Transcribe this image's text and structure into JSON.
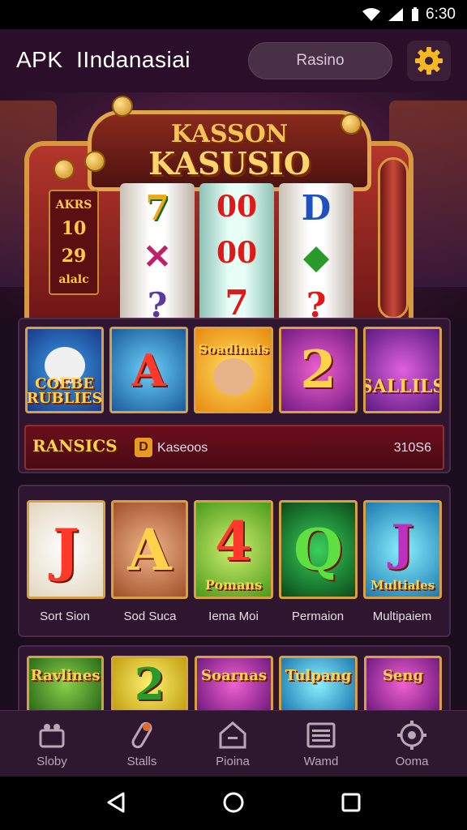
{
  "status_bar": {
    "time": "6:30"
  },
  "header": {
    "app_title": "APK  IIndanasiai",
    "search_placeholder": "Rasino"
  },
  "hero": {
    "logo_line1": "KASSON",
    "logo_line2": "KASUSIO",
    "paytable": [
      "AKRS",
      "10",
      "29",
      "alalc"
    ],
    "reels": [
      [
        "7",
        "✕",
        "?"
      ],
      [
        "00",
        "00",
        "7"
      ],
      [
        "D",
        "◆",
        "?"
      ]
    ]
  },
  "featured_games": [
    {
      "title": "COEBE RUBLIES",
      "bg": "#1a6ab8"
    },
    {
      "title": "A",
      "bg": "#1e8fd0"
    },
    {
      "title": "Soadinais",
      "bg": "#f2a81c"
    },
    {
      "title": "2",
      "bg": "#c02aa0"
    },
    {
      "title": "SALLILS",
      "bg": "#8a1fa8"
    }
  ],
  "jackpot_bar": {
    "logo": "RANSICS",
    "icon": "D",
    "label": "Kaseoos",
    "value": "310S6"
  },
  "game_grid_2": [
    {
      "glyph": "J",
      "caption": "Sort Sion",
      "bg": "#f0e6d6"
    },
    {
      "glyph": "A",
      "caption": "Sod Suca",
      "bg": "#d9875a"
    },
    {
      "glyph": "4",
      "caption": "Iema Moi",
      "bg": "#8fcf3a",
      "label": "Pomans"
    },
    {
      "glyph": "Q",
      "caption": "Permaion",
      "bg": "#1a8a2a"
    },
    {
      "glyph": "J",
      "caption": "Multipaiem",
      "bg": "#2ab0c8",
      "label": "Multiales"
    }
  ],
  "game_grid_3": [
    {
      "title": "Ravlines",
      "bg": "#3a8a2a"
    },
    {
      "title": "2",
      "bg": "#e6d020"
    },
    {
      "title": "Soarnas",
      "bg": "#c02aa0"
    },
    {
      "title": "Tulpang",
      "bg": "#2ab0c8"
    },
    {
      "title": "Seng",
      "bg": "#c02aa0"
    }
  ],
  "bottom_nav": [
    {
      "label": "Sloby",
      "icon": "store-icon"
    },
    {
      "label": "Stalls",
      "icon": "rocket-icon"
    },
    {
      "label": "Pioina",
      "icon": "home-icon"
    },
    {
      "label": "Wamd",
      "icon": "list-icon"
    },
    {
      "label": "Ooma",
      "icon": "gear-icon"
    }
  ],
  "colors": {
    "accent": "#f7b822",
    "header_bg": "#2b0f2a",
    "nav_bg": "#2e182f"
  }
}
